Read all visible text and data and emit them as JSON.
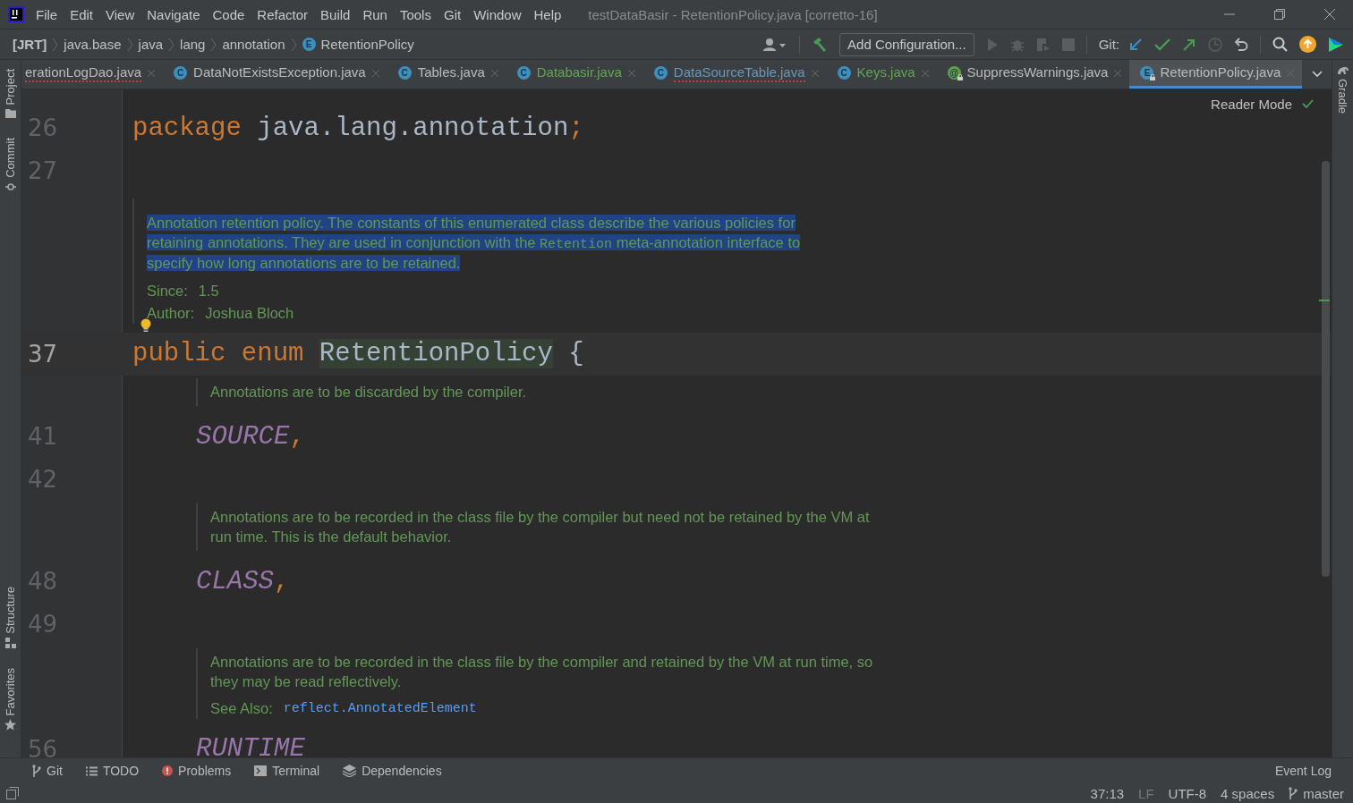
{
  "menu": [
    "File",
    "Edit",
    "View",
    "Navigate",
    "Code",
    "Refactor",
    "Build",
    "Run",
    "Tools",
    "Git",
    "Window",
    "Help"
  ],
  "window": {
    "title": "testDataBasir - RetentionPolicy.java [corretto-16]"
  },
  "breadcrumbs": [
    {
      "label": "[JRT]",
      "kind": "root"
    },
    {
      "label": "java.base",
      "kind": "folder"
    },
    {
      "label": "java",
      "kind": "folder"
    },
    {
      "label": "lang",
      "kind": "folder"
    },
    {
      "label": "annotation",
      "kind": "folder"
    },
    {
      "label": "RetentionPolicy",
      "kind": "enum",
      "badge": "E"
    }
  ],
  "toolbar": {
    "run_config": "Add Configuration...",
    "git_label": "Git:"
  },
  "tabs": [
    {
      "label": "erationLogDao.java",
      "color": "#bbbbbb",
      "errors": true,
      "selected": false
    },
    {
      "label": "DataNotExistsException.java",
      "kind": "class",
      "badge": "C",
      "color": "#bbbbbb",
      "errors": false,
      "locked": false,
      "selected": false
    },
    {
      "label": "Tables.java",
      "kind": "class",
      "badge": "C",
      "color": "#bbbbbb",
      "errors": false,
      "locked": false,
      "selected": false
    },
    {
      "label": "Databasir.java",
      "kind": "class",
      "badge": "C",
      "color": "#62a755",
      "errors": false,
      "locked": false,
      "selected": false
    },
    {
      "label": "DataSourceTable.java",
      "kind": "class",
      "badge": "C",
      "color": "#6897bb",
      "errors": true,
      "locked": false,
      "selected": false
    },
    {
      "label": "Keys.java",
      "kind": "class",
      "badge": "C",
      "color": "#62a755",
      "errors": false,
      "locked": false,
      "selected": false
    },
    {
      "label": "SuppressWarnings.java",
      "kind": "annotation",
      "badge": "@",
      "color": "#bbbbbb",
      "errors": false,
      "locked": true,
      "selected": false
    },
    {
      "label": "RetentionPolicy.java",
      "kind": "enum",
      "badge": "E",
      "color": "#bbbbbb",
      "errors": false,
      "locked": true,
      "selected": true
    }
  ],
  "left_tools": [
    {
      "label": "Project",
      "kind": "folder"
    },
    {
      "label": "Commit",
      "kind": "commit"
    }
  ],
  "left_tools_bottom": [
    {
      "label": "Structure",
      "kind": "structure"
    },
    {
      "label": "Favorites",
      "kind": "star"
    }
  ],
  "right_tools": [
    {
      "label": "Gradle"
    }
  ],
  "editor": {
    "reader_mode": "Reader Mode",
    "lines": [
      {
        "kind": "code",
        "number": "26",
        "nested": false,
        "current": false,
        "tokens": [
          {
            "text": "package",
            "kind": "keyword"
          },
          {
            "text": " java.lang.annotation",
            "kind": "text"
          },
          {
            "text": ";",
            "kind": "punct"
          }
        ]
      },
      {
        "kind": "code",
        "number": "27",
        "current": false
      },
      {
        "kind": "doc",
        "nested": false,
        "selected": true,
        "paragraph": [
          {
            "text": "Annotation retention policy. The constants of this enumerated class describe the various policies for retaining annotations. They are used in conjunction with the ",
            "kind": "text"
          },
          {
            "text": "Retention",
            "kind": "code"
          },
          {
            "text": " meta-annotation interface to specify how long annotations are to be retained.",
            "kind": "text"
          }
        ],
        "meta": [
          {
            "label": "Since:",
            "value": "1.5",
            "kind": "text"
          },
          {
            "label": "Author:",
            "value": "Joshua Bloch",
            "kind": "text"
          }
        ],
        "bulb": true
      },
      {
        "kind": "code",
        "number": "37",
        "nested": false,
        "current": true,
        "tokens": [
          {
            "text": "public enum ",
            "kind": "keyword"
          },
          {
            "text": "RetentionPolicy",
            "kind": "highlight"
          },
          {
            "text": " {",
            "kind": "text"
          }
        ]
      },
      {
        "kind": "doc",
        "nested": true,
        "selected": false,
        "paragraph": [
          {
            "text": "Annotations are to be discarded by the compiler.",
            "kind": "text"
          }
        ]
      },
      {
        "kind": "code",
        "number": "41",
        "nested": true,
        "current": false,
        "tokens": [
          {
            "text": "SOURCE",
            "kind": "constant"
          },
          {
            "text": ",",
            "kind": "punct"
          }
        ]
      },
      {
        "kind": "code",
        "number": "42",
        "current": false
      },
      {
        "kind": "doc",
        "nested": true,
        "selected": false,
        "paragraph": [
          {
            "text": "Annotations are to be recorded in the class file by the compiler but need not be retained by the VM at run time. This is the default behavior.",
            "kind": "text"
          }
        ]
      },
      {
        "kind": "code",
        "number": "48",
        "nested": true,
        "current": false,
        "tokens": [
          {
            "text": "CLASS",
            "kind": "constant"
          },
          {
            "text": ",",
            "kind": "punct"
          }
        ]
      },
      {
        "kind": "code",
        "number": "49",
        "current": false
      },
      {
        "kind": "doc",
        "nested": true,
        "selected": false,
        "paragraph": [
          {
            "text": "Annotations are to be recorded in the class file by the compiler and retained by the VM at run time, so they may be read reflectively.",
            "kind": "text"
          }
        ],
        "meta": [
          {
            "label": "See Also:",
            "value": "reflect.AnnotatedElement",
            "kind": "link"
          }
        ]
      },
      {
        "kind": "code",
        "number": "56",
        "nested": true,
        "current": false,
        "tokens": [
          {
            "text": "RUNTIME",
            "kind": "constant"
          }
        ]
      }
    ]
  },
  "tool_windows": [
    {
      "label": "Git",
      "kind": "branch"
    },
    {
      "label": "TODO",
      "kind": "list"
    },
    {
      "label": "Problems",
      "kind": "error"
    },
    {
      "label": "Terminal",
      "kind": "terminal"
    },
    {
      "label": "Dependencies",
      "kind": "layers"
    }
  ],
  "event_log": "Event Log",
  "status_bar": {
    "position": "37:13",
    "line_separator": "LF",
    "encoding": "UTF-8",
    "indent": "4 spaces",
    "branch": "master"
  }
}
